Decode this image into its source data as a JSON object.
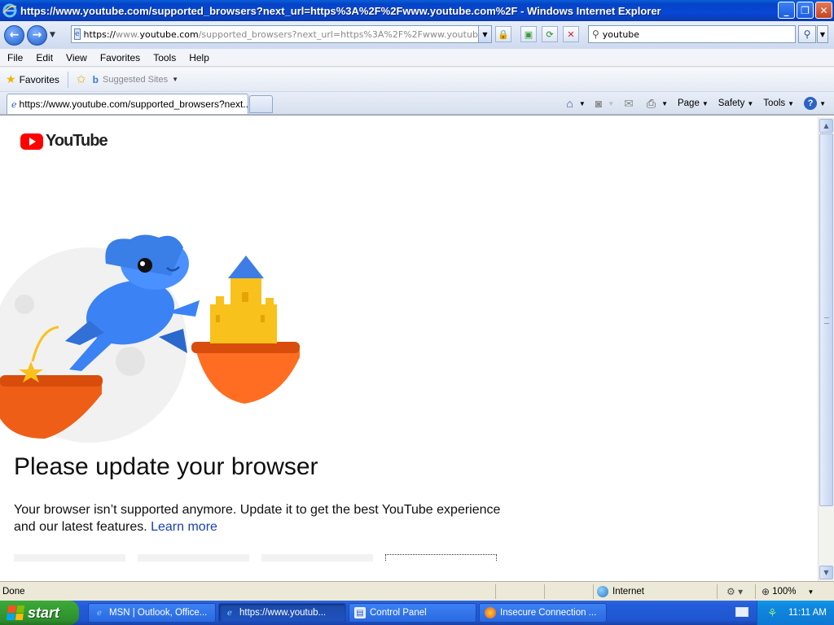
{
  "window": {
    "title": "https://www.youtube.com/supported_browsers?next_url=https%3A%2F%2Fwww.youtube.com%2F - Windows Internet Explorer",
    "minimize": "_",
    "maximize": "❐",
    "close": "✕"
  },
  "address": {
    "scheme": "https://",
    "host_prefix": "www.",
    "host": "youtube.com",
    "path": "/supported_browsers?next_url=https%3A%2F%2Fwww.youtube.com%2F",
    "search_value": "youtube"
  },
  "menu": [
    "File",
    "Edit",
    "View",
    "Favorites",
    "Tools",
    "Help"
  ],
  "favorites": {
    "favorites_label": "Favorites",
    "suggested_label": "Suggested Sites"
  },
  "tab": {
    "label": "https://www.youtube.com/supported_browsers?next..."
  },
  "commands": {
    "page": "Page",
    "safety": "Safety",
    "tools": "Tools",
    "help": "?"
  },
  "page": {
    "logo_text": "YouTube",
    "heading": "Please update your browser",
    "description": "Your browser isn’t supported anymore. Update it to get the best YouTube experience and our latest features.",
    "learn_more": "Learn more"
  },
  "status": {
    "text": "Done",
    "zone": "Internet",
    "zoom": "100%"
  },
  "taskbar": {
    "start": "start",
    "items": [
      {
        "label": "MSN | Outlook, Office..."
      },
      {
        "label": "https://www.youtub..."
      },
      {
        "label": "Control Panel"
      },
      {
        "label": "Insecure Connection ..."
      }
    ],
    "clock": "11:11 AM"
  },
  "colors": {
    "youtube_red": "#ff0000",
    "titlebar_blue": "#0846d6",
    "link_blue": "#1a3fb0",
    "start_green": "#37a435"
  }
}
